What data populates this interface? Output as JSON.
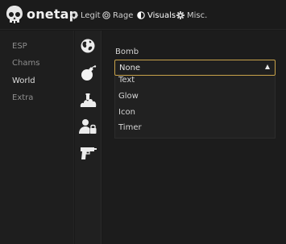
{
  "app": {
    "brand": "onetap"
  },
  "nav": {
    "tabs": [
      {
        "label": "Legit",
        "icon": "crosshair-icon"
      },
      {
        "label": "Rage",
        "icon": "target-icon"
      },
      {
        "label": "Visuals",
        "icon": "half-circle-icon"
      },
      {
        "label": "Misc.",
        "icon": "gear-icon"
      }
    ],
    "active": "Visuals"
  },
  "sidebar": {
    "items": [
      {
        "label": "ESP"
      },
      {
        "label": "Chams"
      },
      {
        "label": "World"
      },
      {
        "label": "Extra"
      }
    ],
    "active": "World"
  },
  "iconbar": {
    "items": [
      "globe-icon",
      "bomb-icon",
      "smoke-grenade-icon",
      "user-lock-icon",
      "gun-icon"
    ],
    "active": "bomb-icon"
  },
  "bomb": {
    "label": "Bomb",
    "value": "None",
    "options": [
      "Text",
      "Glow",
      "Icon",
      "Timer"
    ]
  },
  "colors": {
    "accent": "#c8a24a",
    "background": "#191919",
    "panel": "#1e1e1e"
  }
}
